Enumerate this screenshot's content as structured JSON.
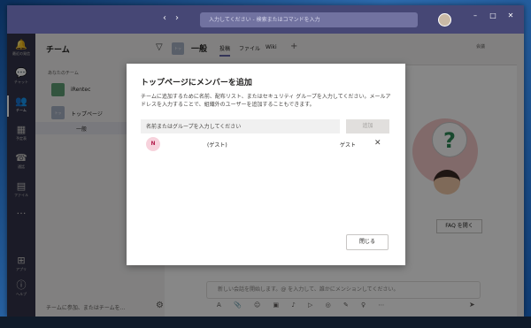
{
  "titlebar": {
    "search_placeholder": "入力してください - 検索またはコマンドを入力"
  },
  "rail": {
    "items": [
      {
        "label": "最近の発信",
        "icon": "bell-icon"
      },
      {
        "label": "チャット",
        "icon": "chat-icon"
      },
      {
        "label": "チーム",
        "icon": "teams-icon"
      },
      {
        "label": "予定表",
        "icon": "calendar-icon"
      },
      {
        "label": "通話",
        "icon": "phone-icon"
      },
      {
        "label": "ファイル",
        "icon": "file-icon"
      },
      {
        "label": "アプリ",
        "icon": "apps-icon"
      },
      {
        "label": "ヘルプ",
        "icon": "help-icon"
      }
    ]
  },
  "teams_panel": {
    "title": "チーム",
    "section_label": "あなたのチーム",
    "team_name": "iRentec",
    "sub_team_name": "トップページ",
    "channel": "一般",
    "footer": "チームに参加、またはチームを..."
  },
  "channel_header": {
    "logo_text": "トッ",
    "title": "一般",
    "tabs": [
      "投稿",
      "ファイル",
      "Wiki"
    ],
    "meeting_label": "会議"
  },
  "main": {
    "faq_button": "FAQ を開く",
    "compose_placeholder": "新しい会話を開始します。@ を入力して、誰かにメンションしてください。"
  },
  "dialog": {
    "title": "トップページにメンバーを追加",
    "description": "チームに追加するために名前、配布リスト、またはセキュリティ グループを入力してください。メールアドレスを入力することで、組織外のユーザーを追加することもできます。",
    "input_placeholder": "名前またはグループを入力してください",
    "add_button": "追加",
    "members": [
      {
        "initial": "N",
        "name": "(ゲスト)",
        "role": "ゲスト"
      }
    ],
    "close_button": "閉じる"
  }
}
